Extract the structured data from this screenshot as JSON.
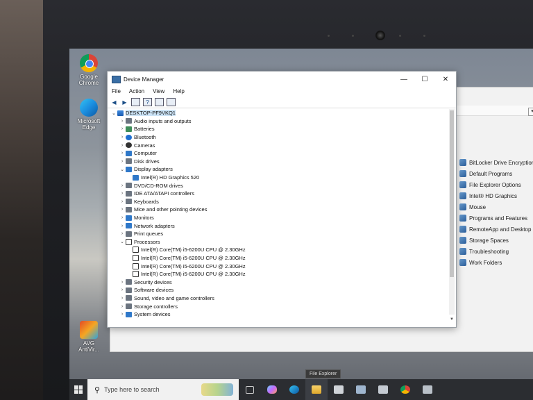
{
  "desktop": {
    "icons": [
      {
        "label": "Google Chrome",
        "icon": "chrome-icon"
      },
      {
        "label": "Microsoft Edge",
        "icon": "edge-icon"
      },
      {
        "label": "AVG AntiVir...",
        "icon": "avg-icon"
      }
    ]
  },
  "background_window": {
    "control_panel_items": [
      "BitLocker Drive Encryption",
      "Default Programs",
      "File Explorer Options",
      "Intel® HD Graphics",
      "Mouse",
      "Programs and Features",
      "RemoteApp and Desktop C",
      "Storage Spaces",
      "Troubleshooting",
      "Work Folders"
    ]
  },
  "device_manager": {
    "title": "Device Manager",
    "menu": [
      "File",
      "Action",
      "View",
      "Help"
    ],
    "root": "DESKTOP-PF9VKQ1",
    "tree": [
      {
        "label": "Audio inputs and outputs",
        "expanded": false
      },
      {
        "label": "Batteries",
        "expanded": false
      },
      {
        "label": "Bluetooth",
        "expanded": false
      },
      {
        "label": "Cameras",
        "expanded": false
      },
      {
        "label": "Computer",
        "expanded": false
      },
      {
        "label": "Disk drives",
        "expanded": false
      },
      {
        "label": "Display adapters",
        "expanded": true
      },
      {
        "label": "Intel(R) HD Graphics 520",
        "child": true
      },
      {
        "label": "DVD/CD-ROM drives",
        "expanded": false
      },
      {
        "label": "IDE ATA/ATAPI controllers",
        "expanded": false
      },
      {
        "label": "Keyboards",
        "expanded": false
      },
      {
        "label": "Mice and other pointing devices",
        "expanded": false
      },
      {
        "label": "Monitors",
        "expanded": false
      },
      {
        "label": "Network adapters",
        "expanded": false
      },
      {
        "label": "Print queues",
        "expanded": false
      },
      {
        "label": "Processors",
        "expanded": true
      },
      {
        "label": "Intel(R) Core(TM) i5-6200U CPU @ 2.30GHz",
        "child": true
      },
      {
        "label": "Intel(R) Core(TM) i5-6200U CPU @ 2.30GHz",
        "child": true
      },
      {
        "label": "Intel(R) Core(TM) i5-6200U CPU @ 2.30GHz",
        "child": true
      },
      {
        "label": "Intel(R) Core(TM) i5-6200U CPU @ 2.30GHz",
        "child": true
      },
      {
        "label": "Security devices",
        "expanded": false
      },
      {
        "label": "Software devices",
        "expanded": false
      },
      {
        "label": "Sound, video and game controllers",
        "expanded": false
      },
      {
        "label": "Storage controllers",
        "expanded": false
      },
      {
        "label": "System devices",
        "expanded": false
      }
    ]
  },
  "taskbar": {
    "search_placeholder": "Type here to search",
    "tooltip": "File Explorer",
    "apps": [
      "task-view-icon",
      "copilot-icon",
      "edge-icon",
      "file-explorer-icon",
      "store-icon",
      "mail-icon",
      "outlook-icon",
      "chrome-icon",
      "app-icon"
    ]
  }
}
